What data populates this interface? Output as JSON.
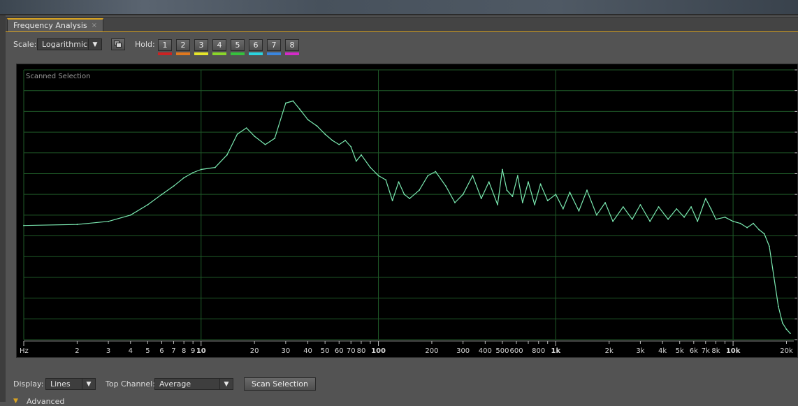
{
  "panel": {
    "tab_label": "Frequency Analysis",
    "tab_close": "×"
  },
  "toolbar": {
    "scale_label": "Scale:",
    "scale_value": "Logarithmic",
    "hold_label": "Hold:",
    "hold_buttons": [
      {
        "label": "1",
        "color": "#cc2222"
      },
      {
        "label": "2",
        "color": "#e0781e"
      },
      {
        "label": "3",
        "color": "#e6e62a"
      },
      {
        "label": "4",
        "color": "#8ad62a"
      },
      {
        "label": "5",
        "color": "#35c23c"
      },
      {
        "label": "6",
        "color": "#2ad4e0"
      },
      {
        "label": "7",
        "color": "#3a86e0"
      },
      {
        "label": "8",
        "color": "#d42ac8"
      }
    ]
  },
  "plot": {
    "caption": "Scanned Selection",
    "unit_label": "Hz",
    "line_color": "#7ae8b0",
    "grid_color": "#1f5a28",
    "tick_labels": [
      {
        "text": "2",
        "f": 2,
        "bold": false
      },
      {
        "text": "3",
        "f": 3,
        "bold": false
      },
      {
        "text": "4",
        "f": 4,
        "bold": false
      },
      {
        "text": "5",
        "f": 5,
        "bold": false
      },
      {
        "text": "6",
        "f": 6,
        "bold": false
      },
      {
        "text": "7",
        "f": 7,
        "bold": false
      },
      {
        "text": "8",
        "f": 8,
        "bold": false
      },
      {
        "text": "9",
        "f": 9,
        "bold": false
      },
      {
        "text": "10",
        "f": 10,
        "bold": true
      },
      {
        "text": "20",
        "f": 20,
        "bold": false
      },
      {
        "text": "30",
        "f": 30,
        "bold": false
      },
      {
        "text": "40",
        "f": 40,
        "bold": false
      },
      {
        "text": "50",
        "f": 50,
        "bold": false
      },
      {
        "text": "60",
        "f": 60,
        "bold": false
      },
      {
        "text": "70",
        "f": 70,
        "bold": false
      },
      {
        "text": "80",
        "f": 80,
        "bold": false
      },
      {
        "text": "100",
        "f": 100,
        "bold": true
      },
      {
        "text": "200",
        "f": 200,
        "bold": false
      },
      {
        "text": "300",
        "f": 300,
        "bold": false
      },
      {
        "text": "400",
        "f": 400,
        "bold": false
      },
      {
        "text": "500",
        "f": 500,
        "bold": false
      },
      {
        "text": "600",
        "f": 600,
        "bold": false
      },
      {
        "text": "800",
        "f": 800,
        "bold": false
      },
      {
        "text": "1k",
        "f": 1000,
        "bold": true
      },
      {
        "text": "2k",
        "f": 2000,
        "bold": false
      },
      {
        "text": "3k",
        "f": 3000,
        "bold": false
      },
      {
        "text": "4k",
        "f": 4000,
        "bold": false
      },
      {
        "text": "5k",
        "f": 5000,
        "bold": false
      },
      {
        "text": "6k",
        "f": 6000,
        "bold": false
      },
      {
        "text": "7k",
        "f": 7000,
        "bold": false
      },
      {
        "text": "8k",
        "f": 8000,
        "bold": false
      },
      {
        "text": "10k",
        "f": 10000,
        "bold": true
      },
      {
        "text": "20k",
        "f": 20000,
        "bold": false
      }
    ]
  },
  "chart_data": {
    "type": "line",
    "xscale": "log",
    "xlim": [
      1,
      22000
    ],
    "ylim": [
      0,
      13
    ],
    "grid": true,
    "series": [
      {
        "x": [
          1,
          2,
          3,
          4,
          5,
          6,
          7,
          8,
          9,
          10,
          12,
          14,
          16,
          18,
          20,
          23,
          26,
          30,
          33,
          36,
          40,
          45,
          50,
          55,
          60,
          65,
          70,
          75,
          80,
          90,
          100,
          110,
          120,
          130,
          140,
          150,
          170,
          190,
          210,
          240,
          270,
          300,
          340,
          380,
          420,
          470,
          500,
          530,
          570,
          610,
          650,
          700,
          760,
          820,
          900,
          1000,
          1100,
          1200,
          1350,
          1500,
          1700,
          1900,
          2100,
          2400,
          2700,
          3000,
          3400,
          3800,
          4300,
          4800,
          5300,
          5800,
          6300,
          6800,
          7000,
          7500,
          8000,
          9000,
          10000,
          11000,
          12000,
          13000,
          14000,
          15000,
          16000,
          17000,
          18000,
          19000,
          20000,
          21000
        ],
        "y": [
          5.5,
          5.55,
          5.7,
          6.0,
          6.5,
          7.0,
          7.4,
          7.8,
          8.05,
          8.2,
          8.3,
          8.9,
          9.9,
          10.2,
          9.8,
          9.4,
          9.7,
          11.4,
          11.5,
          11.1,
          10.6,
          10.3,
          9.9,
          9.6,
          9.4,
          9.6,
          9.3,
          8.6,
          8.9,
          8.3,
          7.9,
          7.7,
          6.7,
          7.6,
          7.0,
          6.8,
          7.2,
          7.9,
          8.1,
          7.4,
          6.6,
          7.0,
          7.9,
          6.8,
          7.6,
          6.5,
          8.2,
          7.2,
          6.9,
          7.9,
          6.6,
          7.6,
          6.5,
          7.5,
          6.7,
          7.0,
          6.3,
          7.1,
          6.2,
          7.2,
          6.0,
          6.6,
          5.7,
          6.4,
          5.8,
          6.5,
          5.7,
          6.4,
          5.8,
          6.3,
          5.9,
          6.4,
          5.7,
          6.5,
          6.8,
          6.3,
          5.8,
          5.9,
          5.7,
          5.6,
          5.4,
          5.6,
          5.3,
          5.1,
          4.5,
          3.0,
          1.6,
          0.8,
          0.5,
          0.3
        ]
      }
    ]
  },
  "bottombar": {
    "display_label": "Display:",
    "display_value": "Lines",
    "topchannel_label": "Top Channel:",
    "topchannel_value": "Average",
    "scan_button": "Scan Selection",
    "advanced_label": "Advanced"
  }
}
